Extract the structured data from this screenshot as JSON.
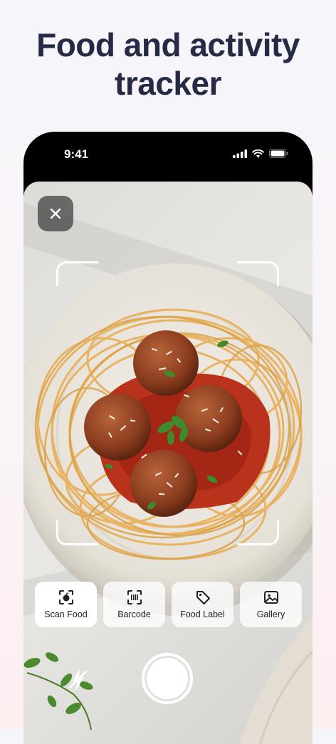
{
  "headline": "Food and activity tracker",
  "status_bar": {
    "time": "9:41"
  },
  "camera": {
    "close_icon": "close-icon",
    "modes": [
      {
        "label": "Scan Food",
        "icon": "scan-food-icon"
      },
      {
        "label": "Barcode",
        "icon": "barcode-icon"
      },
      {
        "label": "Food Label",
        "icon": "tag-icon"
      },
      {
        "label": "Gallery",
        "icon": "gallery-icon"
      }
    ],
    "selected_mode": "Scan Food"
  },
  "colors": {
    "headline": "#262b45",
    "sauce": "#b8321c",
    "pasta": "#e9b560",
    "herb": "#3f8a2a"
  }
}
